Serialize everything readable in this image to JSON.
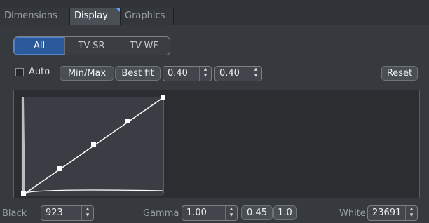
{
  "tabs": [
    "Dimensions",
    "Display",
    "Graphics"
  ],
  "active_tab": "Display",
  "channel_buttons": [
    "All",
    "TV-SR",
    "TV-WF"
  ],
  "active_channel": "All",
  "auto_label": "Auto",
  "auto_checked": false,
  "minmax_label": "Min/Max",
  "bestfit_label": "Best fit",
  "value1": "0.40",
  "value2": "0.40",
  "reset_label": "Reset",
  "black_label": "Black",
  "black_value": "923",
  "gamma_label": "Gamma",
  "gamma_value": "1.00",
  "preset1": "0.45",
  "preset2": "1.0",
  "white_label": "White",
  "white_value": "23691",
  "colors": {
    "accent": "#2a5a9c",
    "curve": "#ffffff"
  }
}
